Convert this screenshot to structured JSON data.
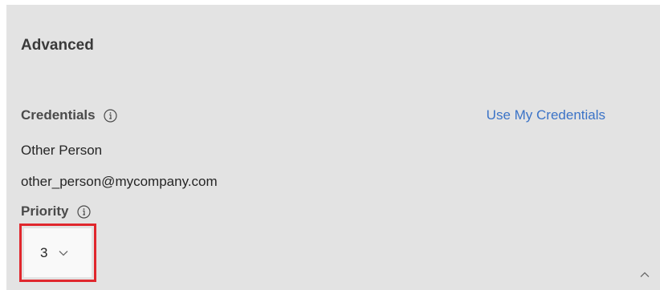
{
  "section": {
    "title": "Advanced"
  },
  "credentials": {
    "label": "Credentials",
    "info_icon": "info-circle-icon",
    "link_label": "Use My Credentials",
    "name": "Other Person",
    "email": "other_person@mycompany.com"
  },
  "priority": {
    "label": "Priority",
    "info_icon": "info-circle-icon",
    "value": "3",
    "dropdown_icon": "chevron-down-icon"
  },
  "collapse": {
    "icon": "chevron-up-icon"
  },
  "colors": {
    "panel_bg": "#e3e3e3",
    "link": "#3b73c7",
    "highlight": "#e0272d"
  }
}
